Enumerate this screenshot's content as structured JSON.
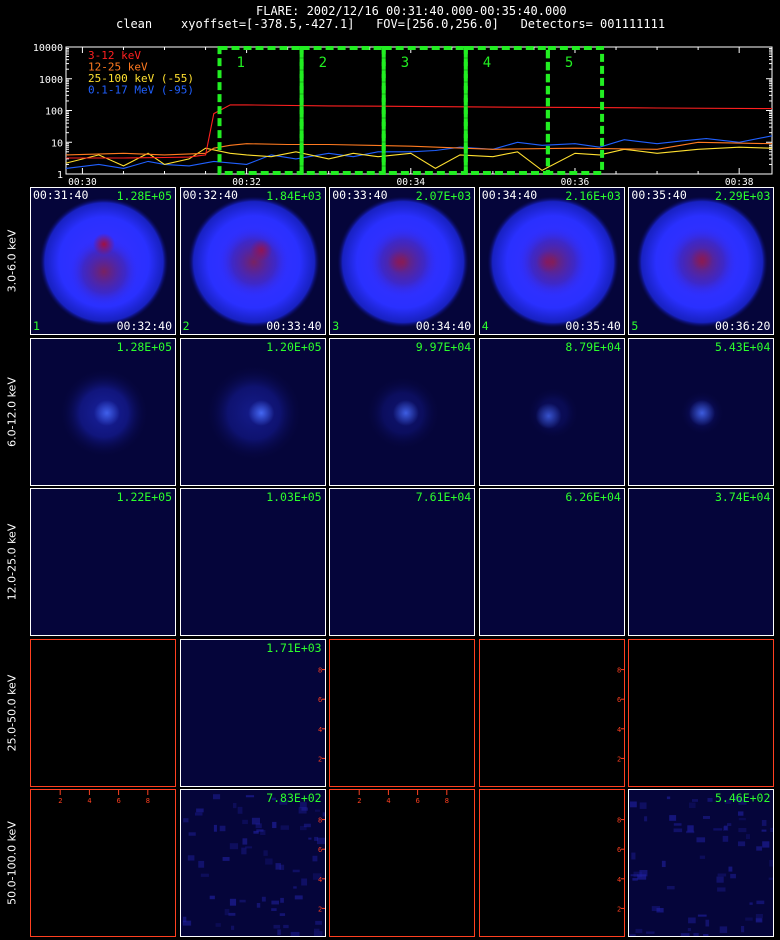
{
  "header": {
    "line1": "FLARE: 2002/12/16 00:31:40.000-00:35:40.000",
    "line2": "clean    xyoffset=[-378.5,-427.1]   FOV=[256.0,256.0]   Detectors= 001111111"
  },
  "colors": {
    "background": "#000000",
    "image_background": "#05053a",
    "empty_cell_border": "#ff4020",
    "interval_box": "#22ee22",
    "annotation_green": "#2cff2c"
  },
  "chart_data": [
    {
      "type": "line",
      "ylog": true,
      "ylim": [
        1,
        10000
      ],
      "yticks": [
        "1",
        "10",
        "100",
        "1000",
        "10000"
      ],
      "xlim": [
        29.8,
        38.4
      ],
      "xticks": [
        {
          "label": "00:30",
          "value": 30
        },
        {
          "label": "00:32",
          "value": 32
        },
        {
          "label": "00:34",
          "value": 34
        },
        {
          "label": "00:36",
          "value": 36
        },
        {
          "label": "00:38",
          "value": 38
        }
      ],
      "legend": {
        "position": "top-left"
      },
      "series": [
        {
          "name": "3-12 keV",
          "color": "#ff2020",
          "x": [
            29.8,
            30.5,
            31.0,
            31.3,
            31.5,
            31.6,
            31.8,
            32.0,
            33.0,
            34.0,
            35.0,
            36.0,
            37.0,
            38.4
          ],
          "y": [
            3.2,
            3.2,
            3.3,
            3.4,
            4,
            80,
            150,
            150,
            140,
            135,
            128,
            125,
            120,
            115
          ]
        },
        {
          "name": "12-25 keV",
          "color": "#ff7a20",
          "x": [
            29.8,
            30.5,
            31.0,
            31.5,
            31.6,
            31.8,
            32.0,
            32.5,
            33.0,
            33.5,
            34.0,
            35.0,
            36.0,
            37.0,
            37.5,
            38.4
          ],
          "y": [
            4,
            4.5,
            4,
            4.5,
            6.5,
            8,
            9,
            8.5,
            8.5,
            8,
            7.5,
            6,
            6.5,
            6,
            10,
            9
          ]
        },
        {
          "name": "25-100 keV (-55)",
          "color": "#ffe030",
          "x": [
            29.8,
            30.2,
            30.5,
            30.8,
            31.0,
            31.3,
            31.5,
            31.8,
            32.0,
            32.3,
            32.6,
            33.0,
            33.3,
            33.6,
            34.0,
            34.3,
            34.6,
            35.0,
            35.3,
            35.6,
            36.0,
            36.3,
            36.6,
            37.0,
            37.5,
            38.0,
            38.4
          ],
          "y": [
            2.2,
            4,
            1.8,
            4.5,
            2,
            3,
            6.5,
            4.5,
            4,
            3.5,
            5,
            3,
            4.5,
            3.5,
            4.5,
            1.5,
            4,
            3.5,
            5,
            1.3,
            4.5,
            4,
            6,
            4.5,
            6,
            7,
            6.5
          ]
        },
        {
          "name": "0.1-17 MeV (-95)",
          "color": "#2060ff",
          "x": [
            29.8,
            30.2,
            30.5,
            30.8,
            31.0,
            31.3,
            31.6,
            32.0,
            32.3,
            32.6,
            33.0,
            33.3,
            33.6,
            34.0,
            34.3,
            34.6,
            35.0,
            35.3,
            35.6,
            36.0,
            36.3,
            36.6,
            37.0,
            37.3,
            37.6,
            38.0,
            38.4
          ],
          "y": [
            1.5,
            2,
            1.5,
            2.5,
            2,
            1.8,
            2.5,
            2,
            4,
            3,
            4.5,
            3.5,
            5,
            5,
            5.5,
            7,
            6,
            10,
            8,
            9,
            7,
            12,
            9,
            11,
            13,
            10,
            16
          ]
        }
      ],
      "intervals": [
        {
          "label": "1",
          "start": 31.67,
          "end": 32.67
        },
        {
          "label": "2",
          "start": 32.67,
          "end": 33.67
        },
        {
          "label": "3",
          "start": 33.67,
          "end": 34.67
        },
        {
          "label": "4",
          "start": 34.67,
          "end": 35.67
        },
        {
          "label": "5",
          "start": 35.67,
          "end": 36.33
        }
      ]
    },
    {
      "type": "heatmap",
      "description_of_grid": "image mosaic, rows = energy bands, columns = time intervals",
      "rows": [
        {
          "band": "3.0-6.0 keV",
          "cells": [
            {
              "max": "1.28E+05",
              "start": "00:31:40",
              "end": "00:32:40",
              "index": "1",
              "kind": "source",
              "halo_radius": 0.88,
              "halo_intensity": 1.0,
              "core_intensity": 1.0,
              "core": [
                0.5,
                0.38
              ]
            },
            {
              "max": "1.84E+03",
              "start": "00:32:40",
              "end": "00:33:40",
              "index": "2",
              "kind": "disk",
              "halo_radius": 0.9,
              "halo_intensity": 1.0,
              "core_intensity": 0.8,
              "core": [
                0.55,
                0.42
              ]
            },
            {
              "max": "2.07E+03",
              "start": "00:33:40",
              "end": "00:34:40",
              "index": "3",
              "kind": "disk",
              "halo_radius": 0.9,
              "halo_intensity": 1.0,
              "core_intensity": 0.5,
              "core": [
                0.47,
                0.5
              ]
            },
            {
              "max": "2.16E+03",
              "start": "00:34:40",
              "end": "00:35:40",
              "index": "4",
              "kind": "disk",
              "halo_radius": 0.9,
              "halo_intensity": 1.0,
              "core_intensity": 0.5,
              "core": [
                0.46,
                0.5
              ]
            },
            {
              "max": "2.29E+03",
              "start": "00:35:40",
              "end": "00:36:20",
              "index": "5",
              "kind": "disk",
              "halo_radius": 0.9,
              "halo_intensity": 1.0,
              "core_intensity": 0.5,
              "core": [
                0.5,
                0.48
              ]
            }
          ]
        },
        {
          "band": "6.0-12.0 keV",
          "cells": [
            {
              "max": "1.28E+05",
              "kind": "blob",
              "halo_radius": 0.6,
              "halo_intensity": 0.55,
              "core_intensity": 0.8,
              "core": [
                0.52,
                0.5
              ]
            },
            {
              "max": "1.20E+05",
              "kind": "blob",
              "halo_radius": 0.65,
              "halo_intensity": 0.45,
              "core_intensity": 0.9,
              "core": [
                0.55,
                0.5
              ]
            },
            {
              "max": "9.97E+04",
              "kind": "blob",
              "halo_radius": 0.5,
              "halo_intensity": 0.3,
              "core_intensity": 0.8,
              "core": [
                0.52,
                0.5
              ]
            },
            {
              "max": "8.79E+04",
              "kind": "blob",
              "halo_radius": 0.35,
              "halo_intensity": 0.2,
              "core_intensity": 0.7,
              "core": [
                0.47,
                0.52
              ]
            },
            {
              "max": "5.43E+04",
              "kind": "blob",
              "halo_radius": 0.3,
              "halo_intensity": 0.2,
              "core_intensity": 0.8,
              "core": [
                0.5,
                0.5
              ]
            }
          ]
        },
        {
          "band": "12.0-25.0 keV",
          "cells": [
            {
              "max": "1.22E+05",
              "kind": "blank",
              "halo_radius": 0,
              "halo_intensity": 0,
              "core_intensity": 0
            },
            {
              "max": "1.03E+05",
              "kind": "blank",
              "halo_radius": 0,
              "halo_intensity": 0,
              "core_intensity": 0
            },
            {
              "max": "7.61E+04",
              "kind": "blank",
              "halo_radius": 0,
              "halo_intensity": 0,
              "core_intensity": 0
            },
            {
              "max": "6.26E+04",
              "kind": "blank",
              "halo_radius": 0,
              "halo_intensity": 0,
              "core_intensity": 0
            },
            {
              "max": "3.74E+04",
              "kind": "blank",
              "halo_radius": 0,
              "halo_intensity": 0,
              "core_intensity": 0
            }
          ]
        },
        {
          "band": "25.0-50.0 keV",
          "cells": [
            {
              "kind": "empty"
            },
            {
              "max": "1.71E+03",
              "kind": "blank",
              "halo_radius": 0,
              "halo_intensity": 0,
              "core_intensity": 0,
              "yaxis": [
                "2",
                "4",
                "6",
                "8"
              ]
            },
            {
              "kind": "empty"
            },
            {
              "kind": "empty",
              "yaxis": [
                "2",
                "4",
                "6",
                "8"
              ]
            },
            {
              "kind": "empty"
            }
          ]
        },
        {
          "band": "50.0-100.0 keV",
          "cells": [
            {
              "kind": "empty",
              "xaxis": [
                "2",
                "4",
                "6",
                "8"
              ]
            },
            {
              "max": "7.83E+02",
              "kind": "noise",
              "halo_radius": 0,
              "halo_intensity": 0,
              "core_intensity": 0,
              "yaxis": [
                "2",
                "4",
                "6",
                "8"
              ]
            },
            {
              "kind": "empty",
              "xaxis": [
                "2",
                "4",
                "6",
                "8"
              ]
            },
            {
              "kind": "empty",
              "yaxis": [
                "2",
                "4",
                "6",
                "8"
              ]
            },
            {
              "max": "5.46E+02",
              "kind": "noise",
              "halo_radius": 0,
              "halo_intensity": 0,
              "core_intensity": 0
            }
          ]
        }
      ]
    }
  ]
}
